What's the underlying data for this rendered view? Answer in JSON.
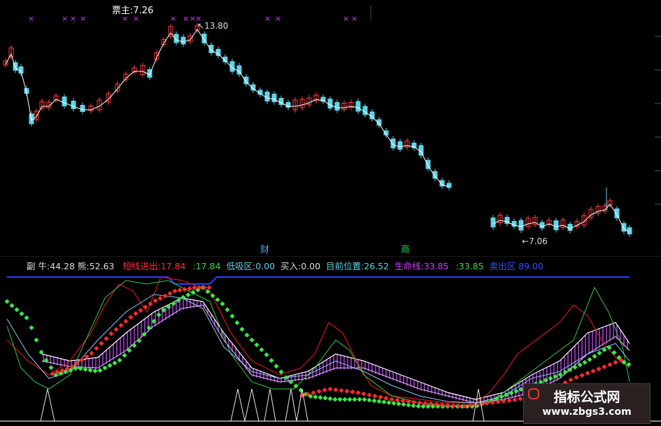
{
  "main_chart": {
    "title_label": "票主",
    "title_value": "7.26",
    "high_marker": "13.80",
    "low_marker": "7.06",
    "signal_mark": "×",
    "tag_cai": "财",
    "tag_shang": "商",
    "colors": {
      "up": "#ff3b3b",
      "down": "#5fd3e8",
      "ma": "#ffffff",
      "mark": "#d040ff"
    }
  },
  "indicator_bar": {
    "fu": "副",
    "niu_label": "牛:",
    "niu_value": "44.28",
    "xiong_label": "熊:",
    "xiong_value": "52.63",
    "short_label": "短线进出:",
    "short_value": "17.84",
    "short2_value": ":17.84",
    "dixi_label": "低吸区:",
    "dixi_value": "0.00",
    "buy_label": "买入:",
    "buy_value": "0.00",
    "pos_label": "目前位置:",
    "pos_value": "26.52",
    "life_label": "生命线:",
    "life_value": "33.85",
    "life2_value": ":33.85",
    "sell_label": "卖出区",
    "sell_value": "89.00"
  },
  "watermark": {
    "title": "指标公式网",
    "url": "www.zbgs3.com"
  }
}
